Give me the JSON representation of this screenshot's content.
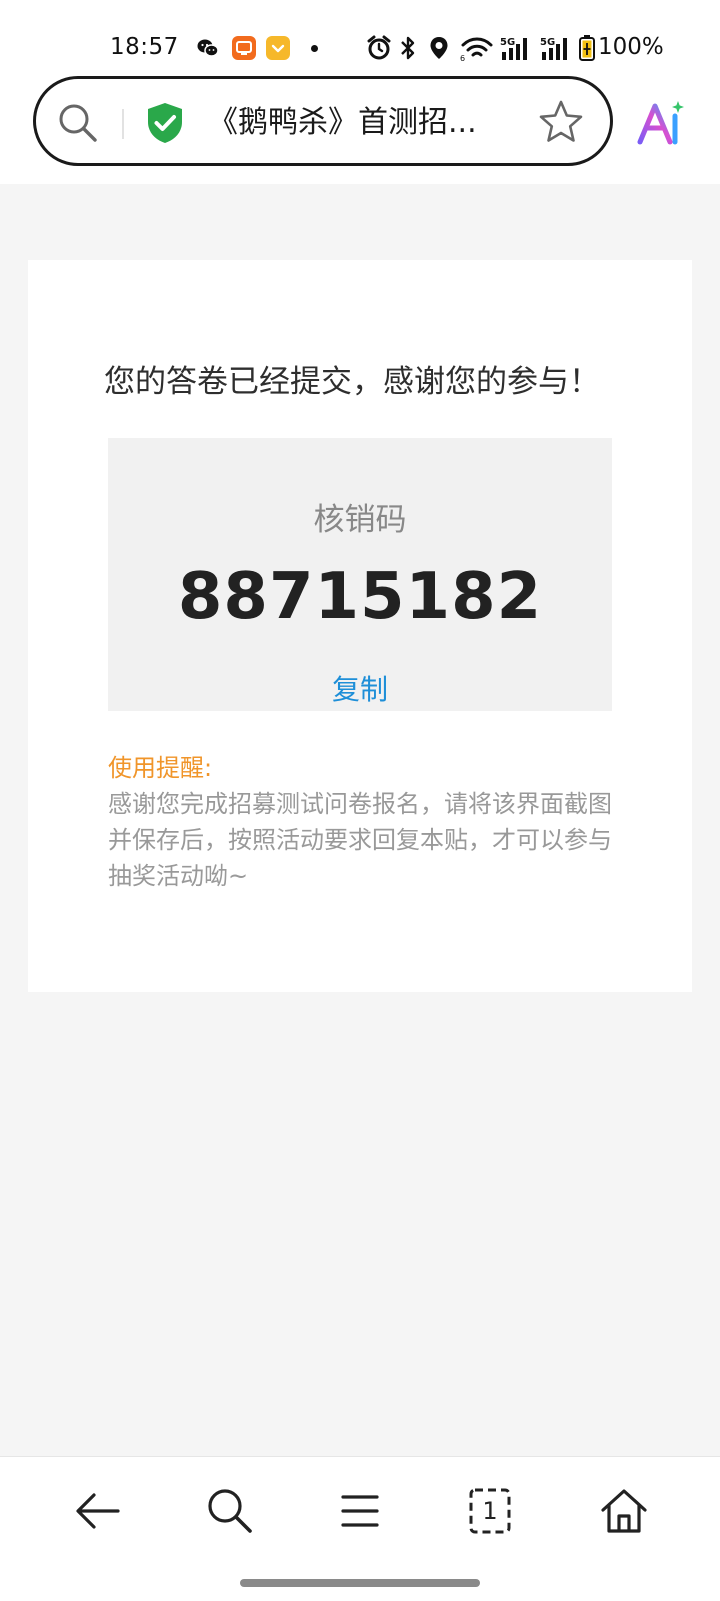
{
  "status_bar": {
    "time": "18:57",
    "battery": "100%",
    "network_1": "5G",
    "network_2": "5G"
  },
  "address_bar": {
    "title": "《鹅鸭杀》首测招..."
  },
  "card": {
    "heading": "您的答卷已经提交，感谢您的参与！",
    "code_label": "核销码",
    "code_value": "88715182",
    "copy_label": "复制",
    "reminder_title": "使用提醒:",
    "reminder_text": "感谢您完成招募测试问卷报名，请将该界面截图并保存后，按照活动要求回复本贴，才可以参与抽奖活动呦~"
  },
  "bottom_nav": {
    "tabs_count": "1"
  },
  "colors": {
    "accent_blue": "#1e8fd8",
    "reminder_orange": "#f0952a",
    "shield_green": "#2aa84a"
  }
}
